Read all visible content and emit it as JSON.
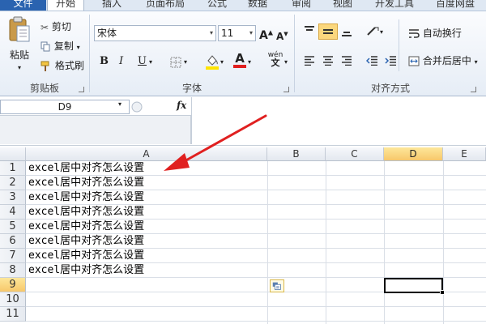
{
  "tabs": {
    "file": "文件",
    "home": "开始",
    "insert": "插入",
    "page_layout": "页面布局",
    "formulas": "公式",
    "data": "数据",
    "review": "审阅",
    "view": "视图",
    "developer": "开发工具",
    "baidu": "百度网盘"
  },
  "clipboard": {
    "paste": "粘贴",
    "cut": "剪切",
    "copy": "复制",
    "format_painter": "格式刷",
    "label": "剪贴板"
  },
  "font": {
    "name": "宋体",
    "size": "11",
    "bold": "B",
    "italic": "I",
    "underline": "U",
    "font_color_letter": "A",
    "phonetic": "wén",
    "label": "字体"
  },
  "alignment": {
    "wrap_text": "自动换行",
    "merge_center": "合并后居中",
    "label": "对齐方式"
  },
  "formula_bar": {
    "name_box": "D9",
    "fx": "fx",
    "value": ""
  },
  "grid": {
    "columns": [
      "A",
      "B",
      "C",
      "D",
      "E"
    ],
    "active_column": "D",
    "rows": [
      "1",
      "2",
      "3",
      "4",
      "5",
      "6",
      "7",
      "8",
      "9",
      "10",
      "11"
    ],
    "active_row": "9",
    "cells_a": [
      "excel居中对齐怎么设置",
      "excel居中对齐怎么设置",
      "excel居中对齐怎么设置",
      "excel居中对齐怎么设置",
      "excel居中对齐怎么设置",
      "excel居中对齐怎么设置",
      "excel居中对齐怎么设置",
      "excel居中对齐怎么设置"
    ]
  },
  "colors": {
    "file_tab": "#2a63b0",
    "active_header": "#f7c76a",
    "arrow": "#e02020",
    "font_color_bar": "#e02020",
    "highlight_bar": "#ffe400"
  }
}
